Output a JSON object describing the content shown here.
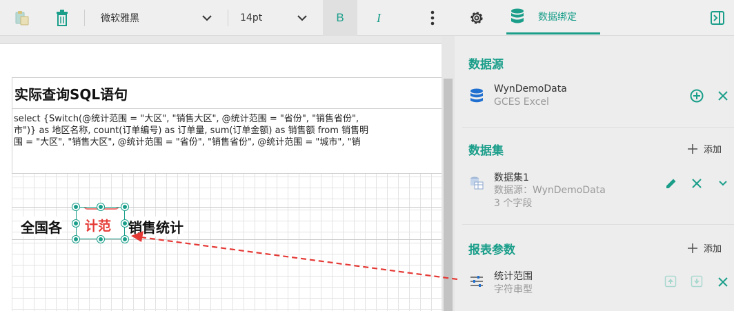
{
  "toolbar": {
    "font_name": "微软雅黑",
    "font_size": "14pt",
    "bold_label": "B",
    "italic_label": "I",
    "data_binding_label": "数据绑定"
  },
  "canvas": {
    "report_title": "实际查询SQL语句",
    "sql_lines": [
      "select {Switch(@统计范围 = \"大区\", \"销售大区\", @统计范围 = \"省份\", \"销售省份\",",
      "市\")} as 地区名称, count(订单编号) as 订单量, sum(订单金额) as 销售额 from 销售明",
      "围 = \"大区\", \"销售大区\", @统计范围 = \"省份\", \"销售省份\", @统计范围 = \"城市\", \"销"
    ],
    "heading_left": "全国各",
    "heading_selected": "计范",
    "heading_right": "销售统计"
  },
  "panel": {
    "datasource": {
      "title": "数据源",
      "name": "WynDemoData",
      "type": "GCES Excel"
    },
    "dataset": {
      "title": "数据集",
      "add_label": "添加",
      "name": "数据集1",
      "source": "数据源：WynDemoData",
      "fields": "3 个字段"
    },
    "params": {
      "title": "报表参数",
      "add_label": "添加",
      "name": "统计范围",
      "type": "字符串型"
    }
  },
  "colors": {
    "accent": "#1a9e8a",
    "arrow": "#e53935",
    "db_icon": "#1f6fd0"
  }
}
